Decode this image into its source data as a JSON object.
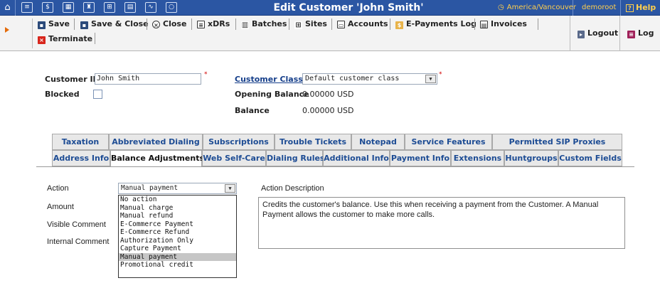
{
  "titlebar": {
    "title": "Edit Customer 'John Smith'",
    "timezone": "America/Vancouver",
    "user": "demoroot",
    "help": "Help",
    "icons": [
      "home-icon",
      "list-icon",
      "dollar-icon",
      "grid-icon",
      "run-icon",
      "hierarchy-icon",
      "card-icon",
      "chart-icon",
      "search-icon"
    ]
  },
  "toolbar": {
    "save": "Save",
    "save_close": "Save & Close",
    "close": "Close",
    "xdrs": "xDRs",
    "batches": "Batches",
    "sites": "Sites",
    "accounts": "Accounts",
    "epayments_log": "E-Payments Log",
    "invoices": "Invoices",
    "terminate": "Terminate",
    "logout": "Logout",
    "log": "Log"
  },
  "form": {
    "customer_id_label": "Customer ID",
    "customer_id_value": "John Smith",
    "blocked_label": "Blocked",
    "customer_class_label": "Customer Class",
    "customer_class_value": "Default customer class",
    "opening_balance_label": "Opening Balance",
    "opening_balance_value": "0.00000 USD",
    "balance_label": "Balance",
    "balance_value": "0.00000 USD"
  },
  "tabs": {
    "row1": [
      "Taxation",
      "Abbreviated Dialing",
      "Subscriptions",
      "Trouble Tickets",
      "Notepad",
      "Service Features",
      "Permitted SIP Proxies"
    ],
    "row2": [
      "Address Info",
      "Balance Adjustments",
      "Web Self-Care",
      "Dialing Rules",
      "Additional Info",
      "Payment Info",
      "Extensions",
      "Huntgroups",
      "Custom Fields"
    ],
    "active": "Balance Adjustments"
  },
  "balance_adjustments": {
    "action_label": "Action",
    "action_value": "Manual payment",
    "amount_label": "Amount",
    "visible_comment_label": "Visible Comment",
    "internal_comment_label": "Internal Comment",
    "action_description_label": "Action Description",
    "action_description": "Credits the customer's balance. Use this when receiving a payment from the Customer. A Manual Payment allows the customer to make more calls.",
    "action_options": [
      "No action",
      "Manual charge",
      "Manual refund",
      "E-Commerce Payment",
      "E-Commerce Refund",
      "Authorization Only",
      "Capture Payment",
      "Manual payment",
      "Promotional credit"
    ],
    "selected_option": "Manual payment"
  },
  "colors": {
    "titlebar_bg": "#2b56a3",
    "accent_orange": "#ffcf4d",
    "link_blue": "#153e8a",
    "required_red": "#d10000"
  }
}
